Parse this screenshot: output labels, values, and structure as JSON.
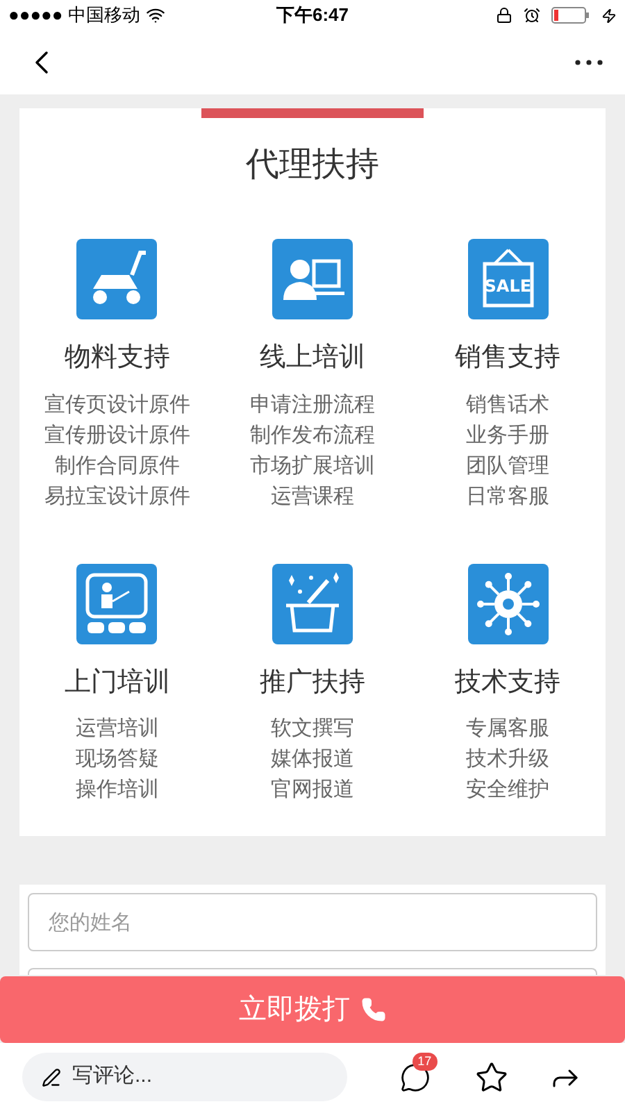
{
  "status_bar": {
    "carrier": "●●●●● 中国移动",
    "time": "下午6:47"
  },
  "title": "代理扶持",
  "sections": [
    {
      "name": "物料支持",
      "items": [
        "宣传页设计原件",
        "宣传册设计原件",
        "制作合同原件",
        "易拉宝设计原件"
      ]
    },
    {
      "name": "线上培训",
      "items": [
        "申请注册流程",
        "制作发布流程",
        "市场扩展培训",
        "运营课程"
      ]
    },
    {
      "name": "销售支持",
      "sale_text": "SALE",
      "items": [
        "销售话术",
        "业务手册",
        "团队管理",
        "日常客服"
      ]
    },
    {
      "name": "上门培训",
      "items": [
        "运营培训",
        "现场答疑",
        "操作培训"
      ]
    },
    {
      "name": "推广扶持",
      "items": [
        "软文撰写",
        "媒体报道",
        "官网报道"
      ]
    },
    {
      "name": "技术支持",
      "items": [
        "专属客服",
        "技术升级",
        "安全维护"
      ]
    }
  ],
  "form": {
    "name_field": {
      "placeholder": "您的姓名"
    }
  },
  "call_button": "立即拨打",
  "bottom_bar": {
    "comment_placeholder": "写评论...",
    "comment_count": "17"
  }
}
